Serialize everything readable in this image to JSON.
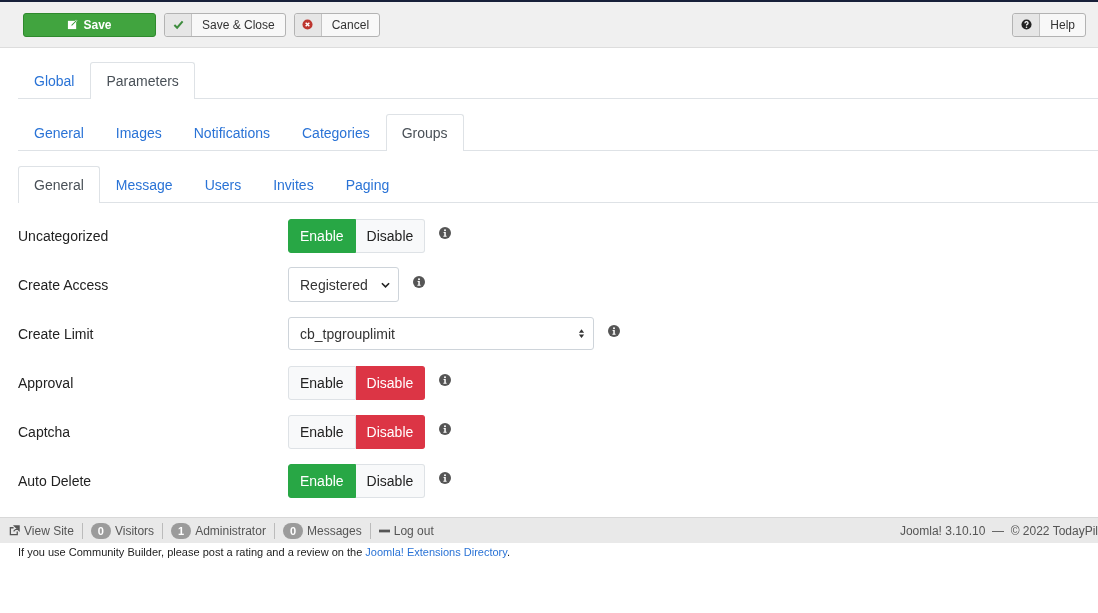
{
  "toolbar": {
    "buttons": [
      {
        "kind": "save",
        "label": "Save"
      },
      {
        "kind": "save-close",
        "label": "Save & Close"
      },
      {
        "kind": "cancel",
        "label": "Cancel"
      }
    ],
    "help": {
      "label": "Help"
    }
  },
  "tab_rows": [
    [
      {
        "label": "Global",
        "selected": false
      },
      {
        "label": "Parameters",
        "selected": true
      }
    ],
    [
      {
        "label": "General",
        "selected": false
      },
      {
        "label": "Images",
        "selected": false
      },
      {
        "label": "Notifications",
        "selected": false
      },
      {
        "label": "Categories",
        "selected": false
      },
      {
        "label": "Groups",
        "selected": true
      }
    ],
    [
      {
        "label": "General",
        "selected": true
      },
      {
        "label": "Message",
        "selected": false
      },
      {
        "label": "Users",
        "selected": false
      },
      {
        "label": "Invites",
        "selected": false
      },
      {
        "label": "Paging",
        "selected": false
      }
    ]
  ],
  "fields": [
    {
      "label": "Uncategorized",
      "kind": "toggle",
      "options": [
        {
          "label": "Enable",
          "selected": true
        },
        {
          "label": "Disable",
          "selected": false
        }
      ]
    },
    {
      "label": "Create Access",
      "kind": "select",
      "value": "Registered"
    },
    {
      "label": "Create Limit",
      "kind": "wide-select",
      "value": "cb_tpgrouplimit"
    },
    {
      "label": "Approval",
      "kind": "toggle",
      "options": [
        {
          "label": "Enable",
          "selected": false
        },
        {
          "label": "Disable",
          "selected": true
        }
      ]
    },
    {
      "label": "Captcha",
      "kind": "toggle",
      "options": [
        {
          "label": "Enable",
          "selected": false
        },
        {
          "label": "Disable",
          "selected": true
        }
      ]
    },
    {
      "label": "Auto Delete",
      "kind": "toggle",
      "options": [
        {
          "label": "Enable",
          "selected": true
        },
        {
          "label": "Disable",
          "selected": false
        }
      ]
    }
  ],
  "status_bar": {
    "view_site": "View Site",
    "counters": [
      {
        "count": "0",
        "label": "Visitors"
      },
      {
        "count": "1",
        "label": "Administrator"
      },
      {
        "count": "0",
        "label": "Messages"
      }
    ],
    "logout": "Log out",
    "version": "Joomla! 3.10.10  —  © 2022 TodayPil"
  },
  "rating": {
    "text": "If you use Community Builder, please post a rating and a review on the ",
    "link": "Joomla! Extensions Directory",
    "end": "."
  }
}
